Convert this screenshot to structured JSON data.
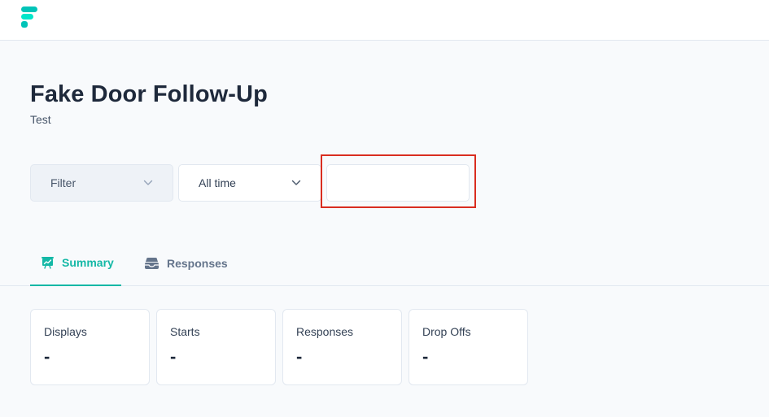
{
  "header": {
    "logo_icon": "formbricks-logo-icon"
  },
  "page": {
    "title": "Fake Door Follow-Up",
    "subtitle": "Test"
  },
  "filters": {
    "filter_label": "Filter",
    "date_range_label": "All time",
    "chevron_icon": "chevron-down-icon"
  },
  "tabs": [
    {
      "label": "Summary",
      "icon": "presentation-chart-icon",
      "active": true
    },
    {
      "label": "Responses",
      "icon": "inbox-stack-icon",
      "active": false
    }
  ],
  "stats": [
    {
      "label": "Displays",
      "value": "-"
    },
    {
      "label": "Starts",
      "value": "-"
    },
    {
      "label": "Responses",
      "value": "-"
    },
    {
      "label": "Drop Offs",
      "value": "-"
    }
  ],
  "colors": {
    "accent": "#14b8a6",
    "highlight": "#d92d20",
    "background": "#f8fafc"
  }
}
